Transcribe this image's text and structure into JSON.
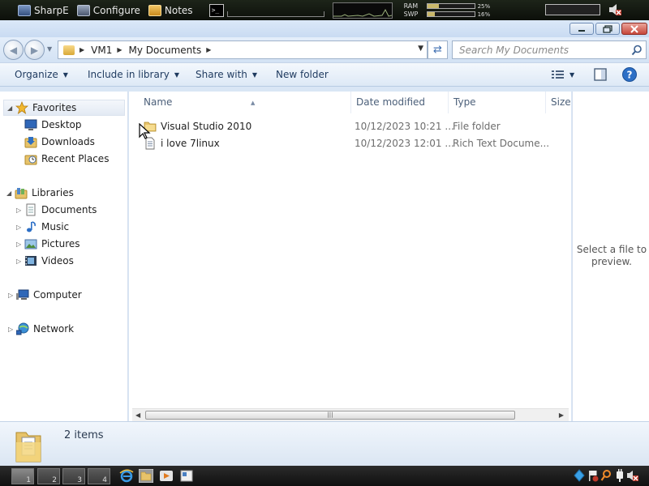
{
  "topbar": {
    "sharpe_label": "SharpE",
    "configure_label": "Configure",
    "notes_label": "Notes",
    "terminal_glyph": ">_",
    "ram_label": "RAM",
    "ram_pct": "25%",
    "ram_value": 0.25,
    "swp_label": "SWP",
    "swp_pct": "16%",
    "swp_value": 0.16
  },
  "address": {
    "crumbs": [
      "VM1",
      "My Documents"
    ],
    "search_placeholder": "Search My Documents"
  },
  "toolbar": {
    "organize": "Organize",
    "include_in_library": "Include in library",
    "share_with": "Share with",
    "new_folder": "New folder"
  },
  "nav": {
    "favorites": "Favorites",
    "desktop": "Desktop",
    "downloads": "Downloads",
    "recent_places": "Recent Places",
    "libraries": "Libraries",
    "documents": "Documents",
    "music": "Music",
    "pictures": "Pictures",
    "videos": "Videos",
    "computer": "Computer",
    "network": "Network"
  },
  "columns": {
    "name": "Name",
    "date_modified": "Date modified",
    "type": "Type",
    "size": "Size"
  },
  "files": [
    {
      "name": "Visual Studio 2010",
      "date": "10/12/2023 10:21 ...",
      "type": "File folder",
      "icon": "folder-icon"
    },
    {
      "name": "i love 7linux",
      "date": "10/12/2023 12:01 ...",
      "type": "Rich Text Docume...",
      "icon": "rich-text-document-icon"
    }
  ],
  "preview": {
    "message": "Select a file to preview."
  },
  "status": {
    "item_count": "2 items"
  },
  "taskbar": {
    "workspaces": [
      "1",
      "2",
      "3",
      "4"
    ]
  }
}
